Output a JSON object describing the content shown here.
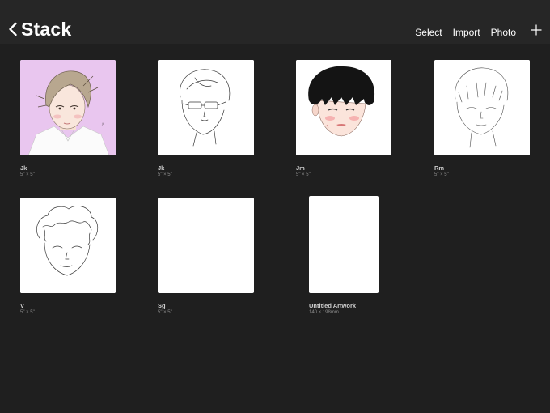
{
  "header": {
    "title": "Stack",
    "back_icon": "chevron-left-icon",
    "actions": {
      "select": "Select",
      "import": "Import",
      "photo": "Photo"
    },
    "add_icon": "plus-icon"
  },
  "artworks": [
    {
      "name": "Jk",
      "size": "5\" × 5\"",
      "preview": "colored portrait, pink background"
    },
    {
      "name": "Jk",
      "size": "5\" × 5\"",
      "preview": "line sketch with glasses"
    },
    {
      "name": "Jm",
      "size": "5\" × 5\"",
      "preview": "colored head, black hair"
    },
    {
      "name": "Rm",
      "size": "5\" × 5\"",
      "preview": "line sketch"
    },
    {
      "name": "V",
      "size": "5\" × 5\"",
      "preview": "line sketch, curly hair"
    },
    {
      "name": "Sg",
      "size": "5\" × 5\"",
      "preview": "blank canvas"
    },
    {
      "name": "Untitled Artwork",
      "size": "140 × 198mm",
      "preview": "blank canvas"
    }
  ],
  "colors": {
    "background": "#1f1f1f",
    "header": "#262626",
    "text": "#ffffff",
    "pink_bg": "#e9c6ef"
  }
}
